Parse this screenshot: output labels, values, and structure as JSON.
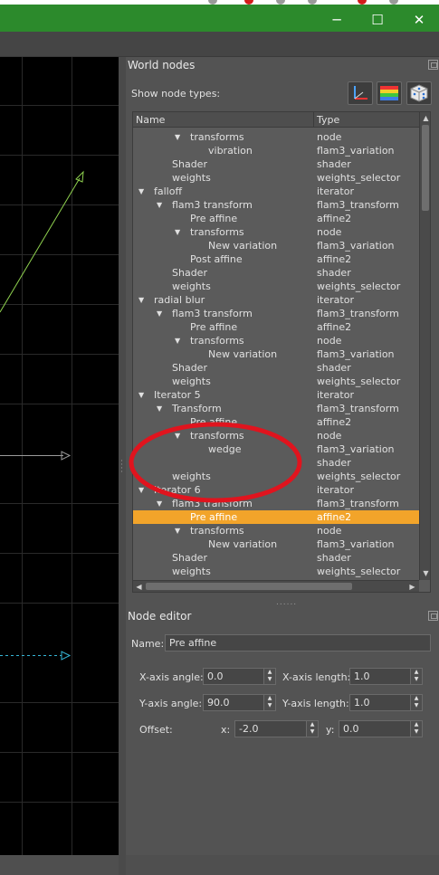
{
  "window": {
    "controls": {
      "minimize": "─",
      "maximize": "☐",
      "close": "✕"
    }
  },
  "world_nodes": {
    "title": "World nodes",
    "show_node_types_label": "Show node types:",
    "type_buttons": [
      {
        "icon": "axes-icon"
      },
      {
        "icon": "gradient-palette-icon"
      },
      {
        "icon": "dice-icon"
      }
    ],
    "columns": {
      "name": "Name",
      "type": "Type"
    },
    "rows": [
      {
        "name": "transforms",
        "type": "node",
        "depth": 2,
        "expanded": true,
        "selected": false
      },
      {
        "name": "vibration",
        "type": "flam3_variation",
        "depth": 3,
        "expanded": null,
        "selected": false
      },
      {
        "name": "Shader",
        "type": "shader",
        "depth": 1,
        "expanded": null,
        "selected": false
      },
      {
        "name": "weights",
        "type": "weights_selector",
        "depth": 1,
        "expanded": null,
        "selected": false
      },
      {
        "name": "falloff",
        "type": "iterator",
        "depth": 0,
        "expanded": true,
        "selected": false
      },
      {
        "name": "flam3 transform",
        "type": "flam3_transform",
        "depth": 1,
        "expanded": true,
        "selected": false
      },
      {
        "name": "Pre affine",
        "type": "affine2",
        "depth": 2,
        "expanded": null,
        "selected": false
      },
      {
        "name": "transforms",
        "type": "node",
        "depth": 2,
        "expanded": true,
        "selected": false
      },
      {
        "name": "New variation",
        "type": "flam3_variation",
        "depth": 3,
        "expanded": null,
        "selected": false
      },
      {
        "name": "Post affine",
        "type": "affine2",
        "depth": 2,
        "expanded": null,
        "selected": false
      },
      {
        "name": "Shader",
        "type": "shader",
        "depth": 1,
        "expanded": null,
        "selected": false
      },
      {
        "name": "weights",
        "type": "weights_selector",
        "depth": 1,
        "expanded": null,
        "selected": false
      },
      {
        "name": "radial blur",
        "type": "iterator",
        "depth": 0,
        "expanded": true,
        "selected": false
      },
      {
        "name": "flam3 transform",
        "type": "flam3_transform",
        "depth": 1,
        "expanded": true,
        "selected": false
      },
      {
        "name": "Pre affine",
        "type": "affine2",
        "depth": 2,
        "expanded": null,
        "selected": false
      },
      {
        "name": "transforms",
        "type": "node",
        "depth": 2,
        "expanded": true,
        "selected": false
      },
      {
        "name": "New variation",
        "type": "flam3_variation",
        "depth": 3,
        "expanded": null,
        "selected": false
      },
      {
        "name": "Shader",
        "type": "shader",
        "depth": 1,
        "expanded": null,
        "selected": false
      },
      {
        "name": "weights",
        "type": "weights_selector",
        "depth": 1,
        "expanded": null,
        "selected": false
      },
      {
        "name": "Iterator 5",
        "type": "iterator",
        "depth": 0,
        "expanded": true,
        "selected": false
      },
      {
        "name": "Transform",
        "type": "flam3_transform",
        "depth": 1,
        "expanded": true,
        "selected": false
      },
      {
        "name": "Pre affine",
        "type": "affine2",
        "depth": 2,
        "expanded": null,
        "selected": false
      },
      {
        "name": "transforms",
        "type": "node",
        "depth": 2,
        "expanded": true,
        "selected": false
      },
      {
        "name": "wedge",
        "type": "flam3_variation",
        "depth": 3,
        "expanded": null,
        "selected": false
      },
      {
        "name": "",
        "type": "shader",
        "depth": 1,
        "expanded": null,
        "selected": false
      },
      {
        "name": "weights",
        "type": "weights_selector",
        "depth": 1,
        "expanded": null,
        "selected": false
      },
      {
        "name": "Iterator 6",
        "type": "iterator",
        "depth": 0,
        "expanded": true,
        "selected": false
      },
      {
        "name": "flam3 transform",
        "type": "flam3_transform",
        "depth": 1,
        "expanded": true,
        "selected": false
      },
      {
        "name": "Pre affine",
        "type": "affine2",
        "depth": 2,
        "expanded": null,
        "selected": true
      },
      {
        "name": "transforms",
        "type": "node",
        "depth": 2,
        "expanded": true,
        "selected": false
      },
      {
        "name": "New variation",
        "type": "flam3_variation",
        "depth": 3,
        "expanded": null,
        "selected": false
      },
      {
        "name": "Shader",
        "type": "shader",
        "depth": 1,
        "expanded": null,
        "selected": false
      },
      {
        "name": "weights",
        "type": "weights_selector",
        "depth": 1,
        "expanded": null,
        "selected": false
      }
    ],
    "selection_color": "#f2a42a"
  },
  "node_editor": {
    "title": "Node editor",
    "name_label": "Name:",
    "name_value": "Pre affine",
    "x_axis_angle_label": "X-axis angle:",
    "x_axis_angle_value": "0.0",
    "x_axis_length_label": "X-axis length:",
    "x_axis_length_value": "1.0",
    "y_axis_angle_label": "Y-axis angle:",
    "y_axis_angle_value": "90.0",
    "y_axis_length_label": "Y-axis length:",
    "y_axis_length_value": "1.0",
    "offset_label": "Offset:",
    "offset_x_label": "x:",
    "offset_x_value": "-2.0",
    "offset_y_label": "y:",
    "offset_y_value": "0.0"
  },
  "colors": {
    "titlebar": "#2c8a2c",
    "annotation_circle": "#e0141e",
    "viewport_green_axis": "#8fd14f",
    "viewport_blue_axis": "#36b6d6",
    "viewport_grey_axis": "#9a9a9a"
  }
}
